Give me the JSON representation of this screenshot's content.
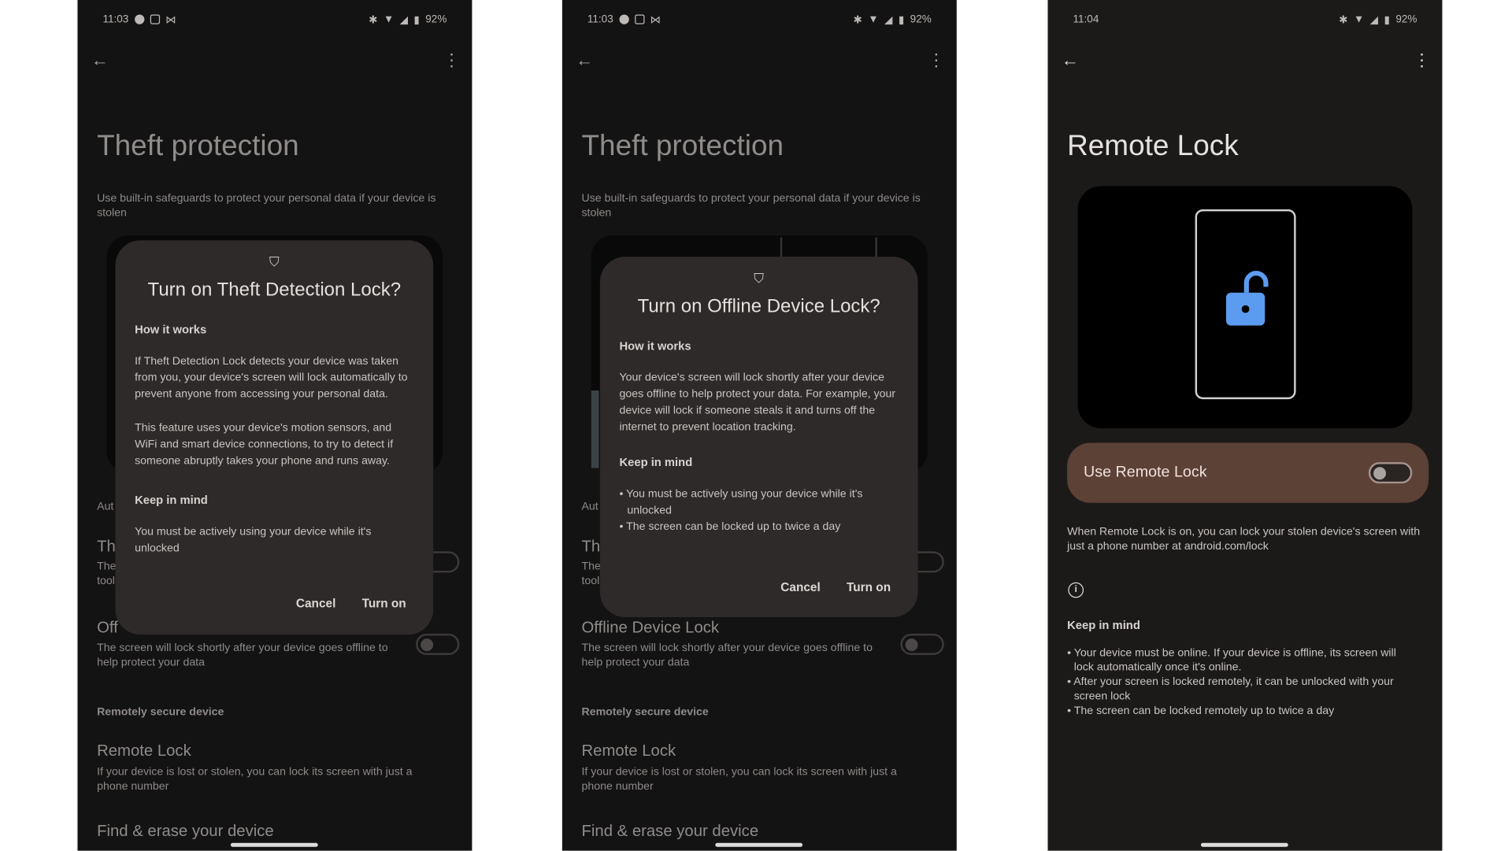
{
  "screens": [
    {
      "time": "11:03",
      "battery": "92%",
      "title": "Theft protection",
      "subtitle": "Use built-in safeguards to protect your personal data if your device is stolen",
      "dialog": {
        "title": "Turn on Theft Detection Lock?",
        "how_heading": "How it works",
        "paragraphs": [
          "If Theft Detection Lock detects your device was taken from you, your device's screen will lock automatically to prevent anyone from accessing your personal data.",
          "This feature uses your device's motion sensors, and WiFi and smart device connections, to try to detect if someone abruptly takes your phone and runs away."
        ],
        "keep_heading": "Keep in mind",
        "keep_text": "You must be actively using your device while it's unlocked",
        "cancel": "Cancel",
        "confirm": "Turn on"
      },
      "bg": {
        "section1": "Aut",
        "item1_title": "Th",
        "item1_l1": "The",
        "item1_l2": "tool",
        "item2_title": "Off",
        "item2_desc": "The screen will lock shortly after your device goes offline to help protect your data",
        "section2": "Remotely secure device",
        "item3_title": "Remote Lock",
        "item3_desc": "If your device is lost or stolen, you can lock its screen with just a phone number",
        "item4_title": "Find & erase your device"
      }
    },
    {
      "time": "11:03",
      "battery": "92%",
      "title": "Theft protection",
      "subtitle": "Use built-in safeguards to protect your personal data if your device is stolen",
      "dialog": {
        "title": "Turn on Offline Device Lock?",
        "how_heading": "How it works",
        "paragraph": "Your device's screen will lock shortly after your device goes offline to help protect your data. For example, your device will lock if someone steals it and turns off the internet to prevent location tracking.",
        "keep_heading": "Keep in mind",
        "bullets": [
          "You must be actively using your device while it's unlocked",
          "The screen can be locked up to twice a day"
        ],
        "cancel": "Cancel",
        "confirm": "Turn on"
      },
      "bg": {
        "section1": "Aut",
        "item1_title": "Th",
        "item1_l1": "The",
        "item1_l2": "tool",
        "item2_title": "Offline Device Lock",
        "item2_desc": "The screen will lock shortly after your device goes offline to help protect your data",
        "section2": "Remotely secure device",
        "item3_title": "Remote Lock",
        "item3_desc": "If your device is lost or stolen, you can lock its screen with just a phone number",
        "item4_title": "Find & erase your device"
      }
    },
    {
      "time": "11:04",
      "battery": "92%",
      "title": "Remote Lock",
      "toggle_label": "Use Remote Lock",
      "toggle_on": false,
      "description": "When Remote Lock is on, you can lock your stolen device's screen with just a phone number at android.com/lock",
      "keep_heading": "Keep in mind",
      "bullets": [
        "Your device must be online. If your device is offline, its screen will lock automatically once it's online.",
        "After your screen is locked remotely, it can be unlocked with your screen lock",
        "The screen can be locked remotely up to twice a day"
      ]
    }
  ],
  "colors": {
    "card": "#5c4136",
    "lock_blue": "#5b9cf0",
    "dialog_bg": "#2d2a29"
  }
}
